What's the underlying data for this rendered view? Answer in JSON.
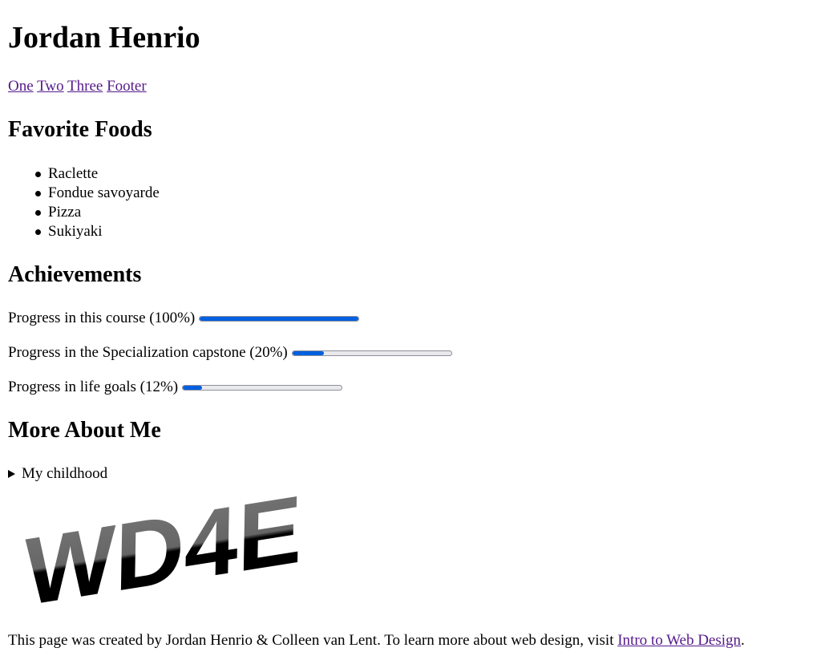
{
  "page": {
    "title": "Jordan Henrio"
  },
  "nav": {
    "links": [
      "One",
      "Two",
      "Three",
      "Footer"
    ]
  },
  "foods": {
    "heading": "Favorite Foods",
    "items": [
      "Raclette",
      "Fondue savoyarde",
      "Pizza",
      "Sukiyaki"
    ]
  },
  "achievements": {
    "heading": "Achievements",
    "items": [
      {
        "label": "Progress in this course (100%)",
        "value": 1.0
      },
      {
        "label": "Progress in the Specialization capstone (20%)",
        "value": 0.2
      },
      {
        "label": "Progress in life goals (12%)",
        "value": 0.12
      }
    ]
  },
  "more": {
    "heading": "More About Me",
    "summary": "My childhood"
  },
  "logo": {
    "text": "WD4E"
  },
  "footer": {
    "text": "This page was created by Jordan Henrio & Colleen van Lent. To learn more about web design, visit ",
    "link": "Intro to Web Design",
    "end": "."
  },
  "colors": {
    "link": "#551a8b",
    "progress": "#0060df"
  }
}
